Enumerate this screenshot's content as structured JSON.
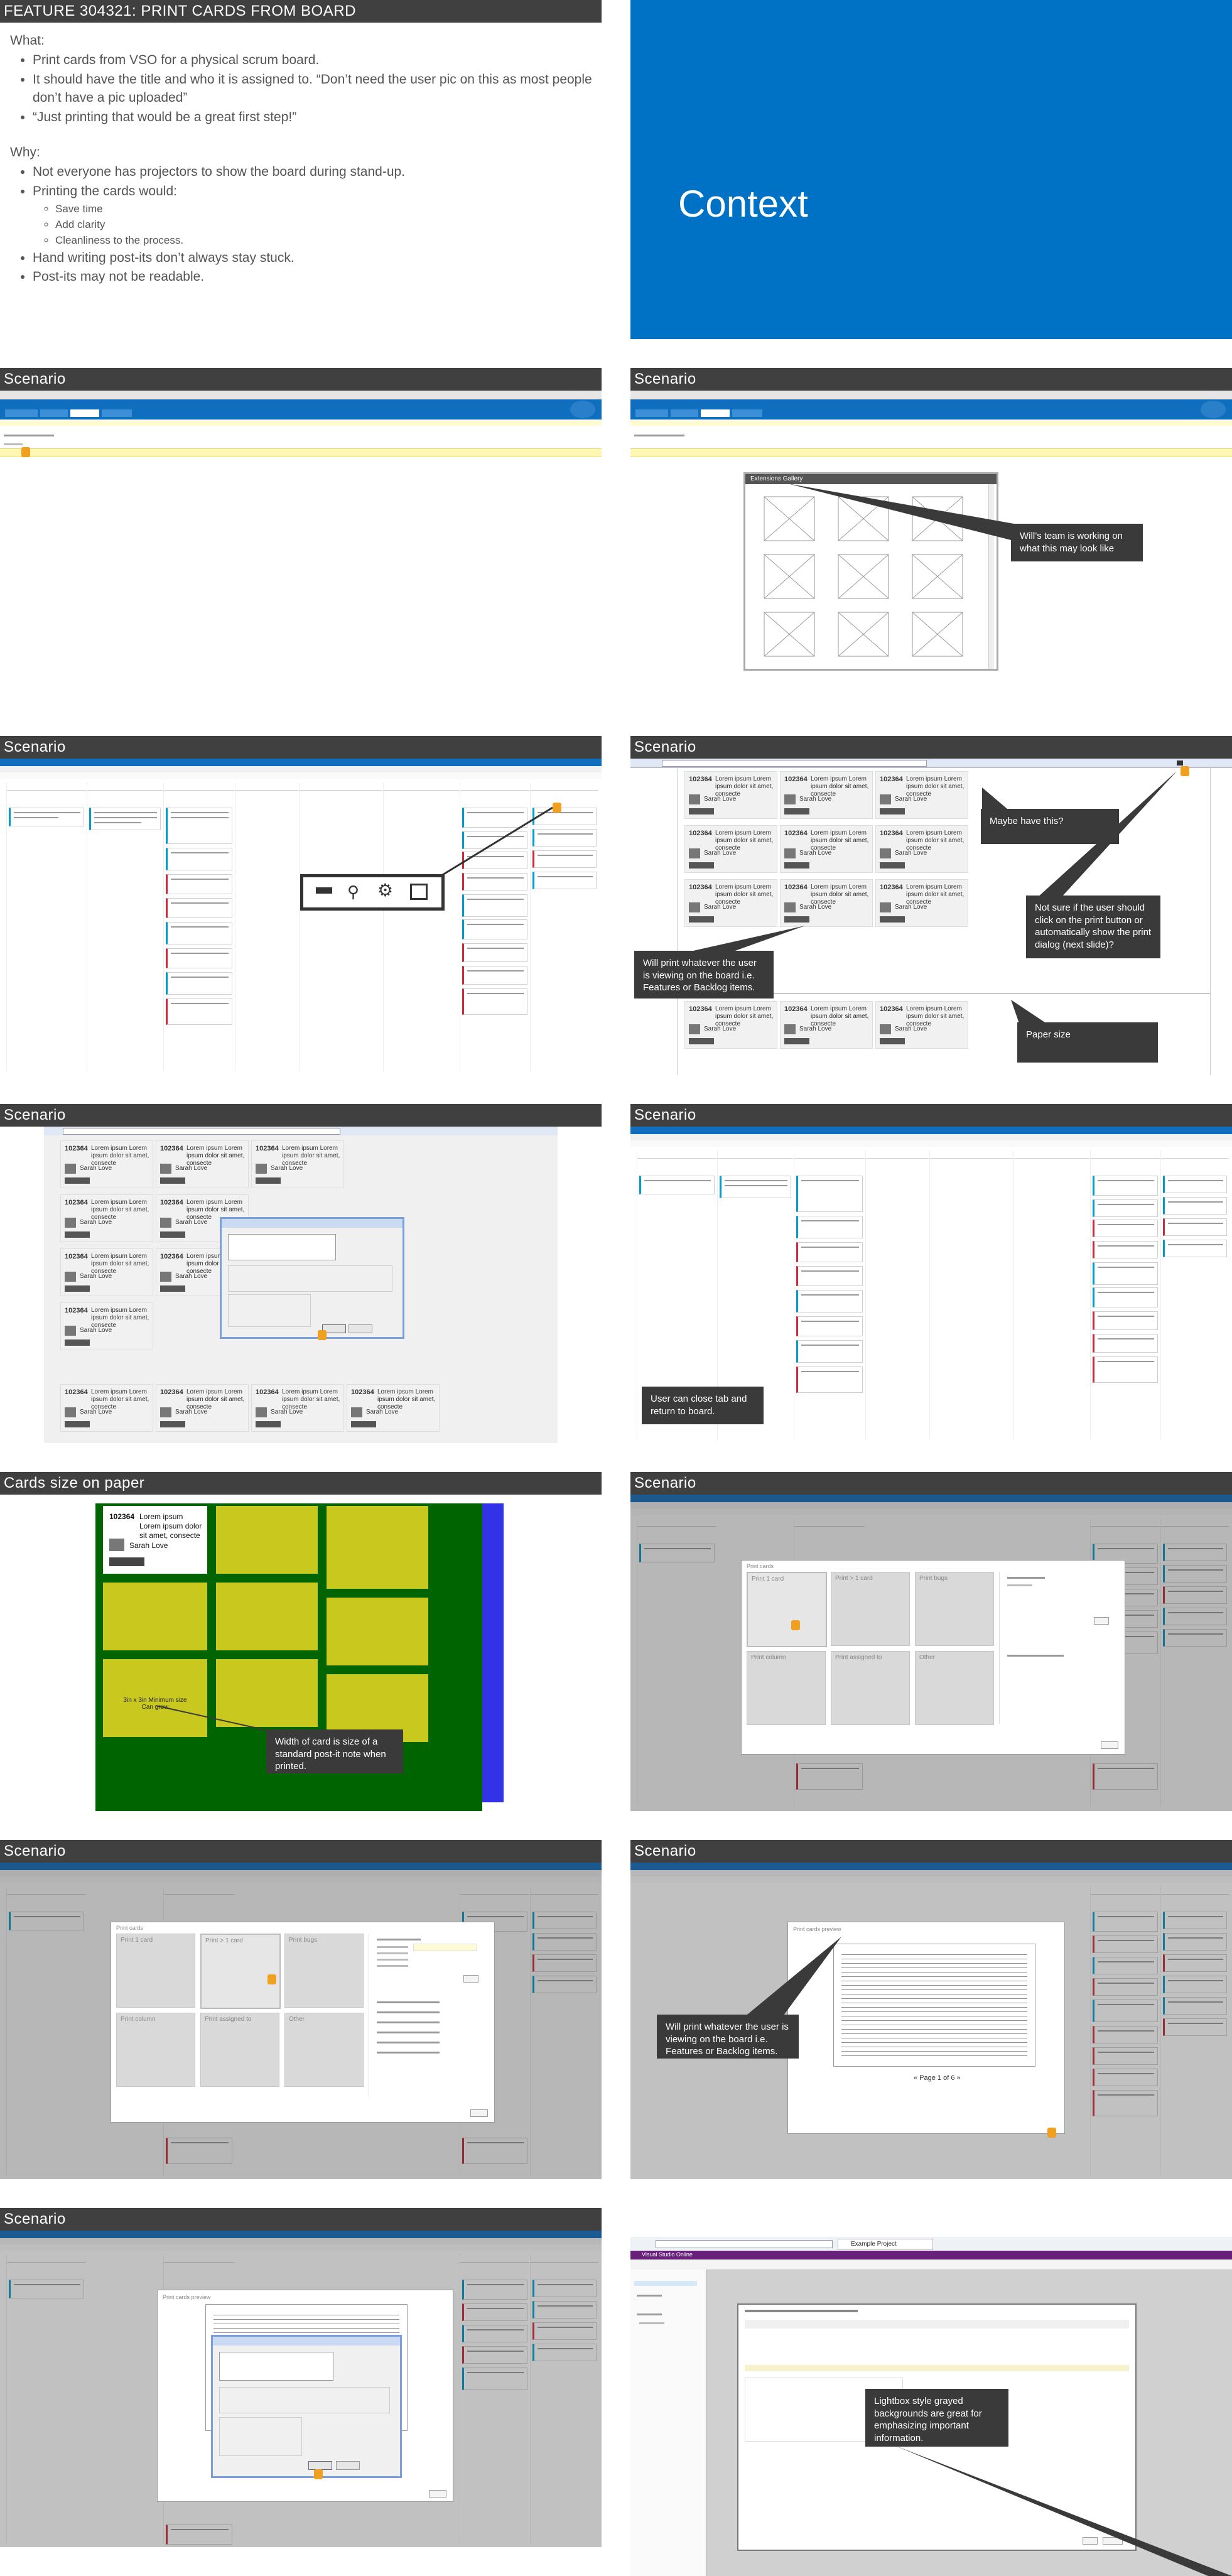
{
  "slides": {
    "s1": {
      "title": "FEATURE 304321: PRINT CARDS FROM BOARD",
      "what_heading": "What:",
      "what_items": [
        "Print cards from VSO for a physical scrum board.",
        "It should have the title and who it is assigned to. “Don’t need the user pic on this as most people don’t have a pic uploaded”",
        "“Just printing that would be a great first step!”"
      ],
      "why_heading": "Why:",
      "why_items": [
        "Not everyone has projectors to show the board during stand-up.",
        "Printing the cards would:",
        "Hand writing post-its don’t always stay stuck.",
        "Post-its may not be readable."
      ],
      "why_subitems": [
        "Save time",
        "Add clarity",
        "Cleanliness to the process."
      ]
    },
    "s2": {
      "title": "Context"
    },
    "scenario_title": "Scenario",
    "s4": {
      "dialog_title": "Extensions Gallery",
      "callout": "Will’s team is working on what this may look like"
    },
    "s6": {
      "callout_maybe": "Maybe have this?",
      "callout_unsure": "Not sure if the user should click on the print button or automatically show the print dialog (next slide)?",
      "callout_print": "Will print whatever the user is viewing on the board i.e. Features or Backlog items.",
      "callout_paper": "Paper size"
    },
    "print_card": {
      "id": "102364",
      "text": "Lorem ipsum Lorem ipsum dolor sit amet, consecte",
      "name": "Sarah Love"
    },
    "s8": {
      "callout": "User can close tab and return to board."
    },
    "s9": {
      "title": "Cards size on paper",
      "card_id": "102364",
      "card_text": "Lorem ipsum Lorem ipsum dolor sit amet, consecte",
      "card_name": "Sarah Love",
      "size_note": "3in x 3in Minimum size\nCan grow",
      "callout": "Width of card is size of a standard post-it note when printed."
    },
    "s10": {
      "dialog_title": "Print cards",
      "options": [
        "Print 1 card",
        "Print > 1 card",
        "Print bugs",
        "Print column",
        "Print assigned to",
        "Other"
      ]
    },
    "s12": {
      "dialog_title": "Print cards preview",
      "callout": "Will print whatever the user is viewing on the board i.e. Features or Backlog items.",
      "pager": "« Page 1 of 6 »"
    },
    "s13": {
      "dialog_title": "Print cards preview"
    },
    "s14": {
      "callout": "Lightbox style grayed backgrounds are great for emphasizing important information.",
      "tab": "Example Project",
      "app": "Visual Studio Online"
    }
  },
  "colors": {
    "title_bar": "#404040",
    "context_blue": "#0072c6",
    "callout": "#3a3a3a",
    "vso_blue": "#106ebe",
    "paper_green": "#006400",
    "postit_yellow": "#c8c81e",
    "side_blue": "#3232e6"
  }
}
